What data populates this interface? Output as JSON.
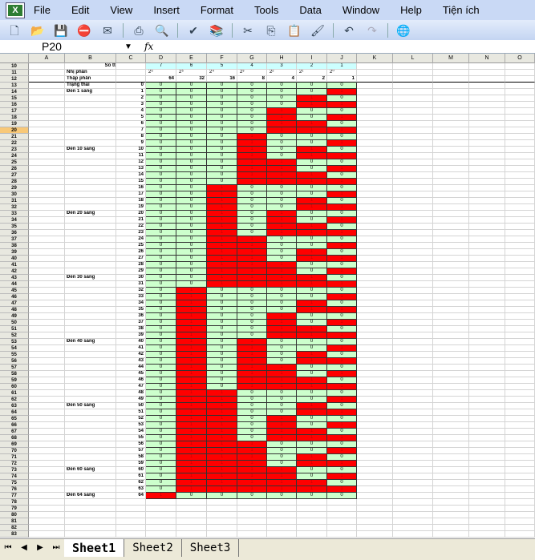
{
  "menu": {
    "items": [
      "File",
      "Edit",
      "View",
      "Insert",
      "Format",
      "Tools",
      "Data",
      "Window",
      "Help",
      "Tiện ích"
    ]
  },
  "namebox": "P20",
  "fx": "fx",
  "columns": [
    "A",
    "B",
    "C",
    "D",
    "E",
    "F",
    "G",
    "H",
    "I",
    "J",
    "K",
    "L",
    "M",
    "N",
    "O"
  ],
  "selected_row": 20,
  "header_rows": {
    "row10": {
      "label": "Số tt",
      "values": [
        "7",
        "6",
        "5",
        "4",
        "3",
        "2",
        "1"
      ]
    },
    "row11": {
      "label": "Nhị phân",
      "values": [
        "2⁶",
        "2⁵",
        "2⁴",
        "2³",
        "2²",
        "2¹",
        "2⁰"
      ]
    },
    "row12": {
      "label": "Thập phân",
      "values": [
        "64",
        "32",
        "16",
        "8",
        "4",
        "2",
        "1"
      ]
    }
  },
  "labels": {
    "13": "Trạng thái",
    "14": "Đèn 1 sáng",
    "23": "Đèn 10 sáng",
    "33": "Đèn 20 sáng",
    "43": "Đèn 30 sáng",
    "53": "Đèn 40 sáng",
    "63": "Đèn 50 sáng",
    "73": "Đèn 60 sáng",
    "77": "Đèn 64 sáng"
  },
  "first_data_row": 13,
  "last_row": 83,
  "values": [
    0,
    1,
    2,
    3,
    4,
    5,
    6,
    7,
    8,
    9,
    10,
    11,
    12,
    13,
    14,
    15,
    16,
    17,
    18,
    19,
    20,
    21,
    22,
    23,
    24,
    25,
    26,
    27,
    28,
    29,
    30,
    31,
    32,
    33,
    34,
    35,
    36,
    37,
    38,
    39,
    40,
    41,
    42,
    43,
    44,
    45,
    46,
    47,
    48,
    49,
    50,
    51,
    52,
    53,
    54,
    55,
    56,
    57,
    58,
    59,
    60,
    61,
    62,
    63,
    64
  ],
  "colors": {
    "on": "#ff0000",
    "off": "#ccffcc"
  },
  "sheets": [
    "Sheet1",
    "Sheet2",
    "Sheet3"
  ],
  "active_sheet": "Sheet1"
}
